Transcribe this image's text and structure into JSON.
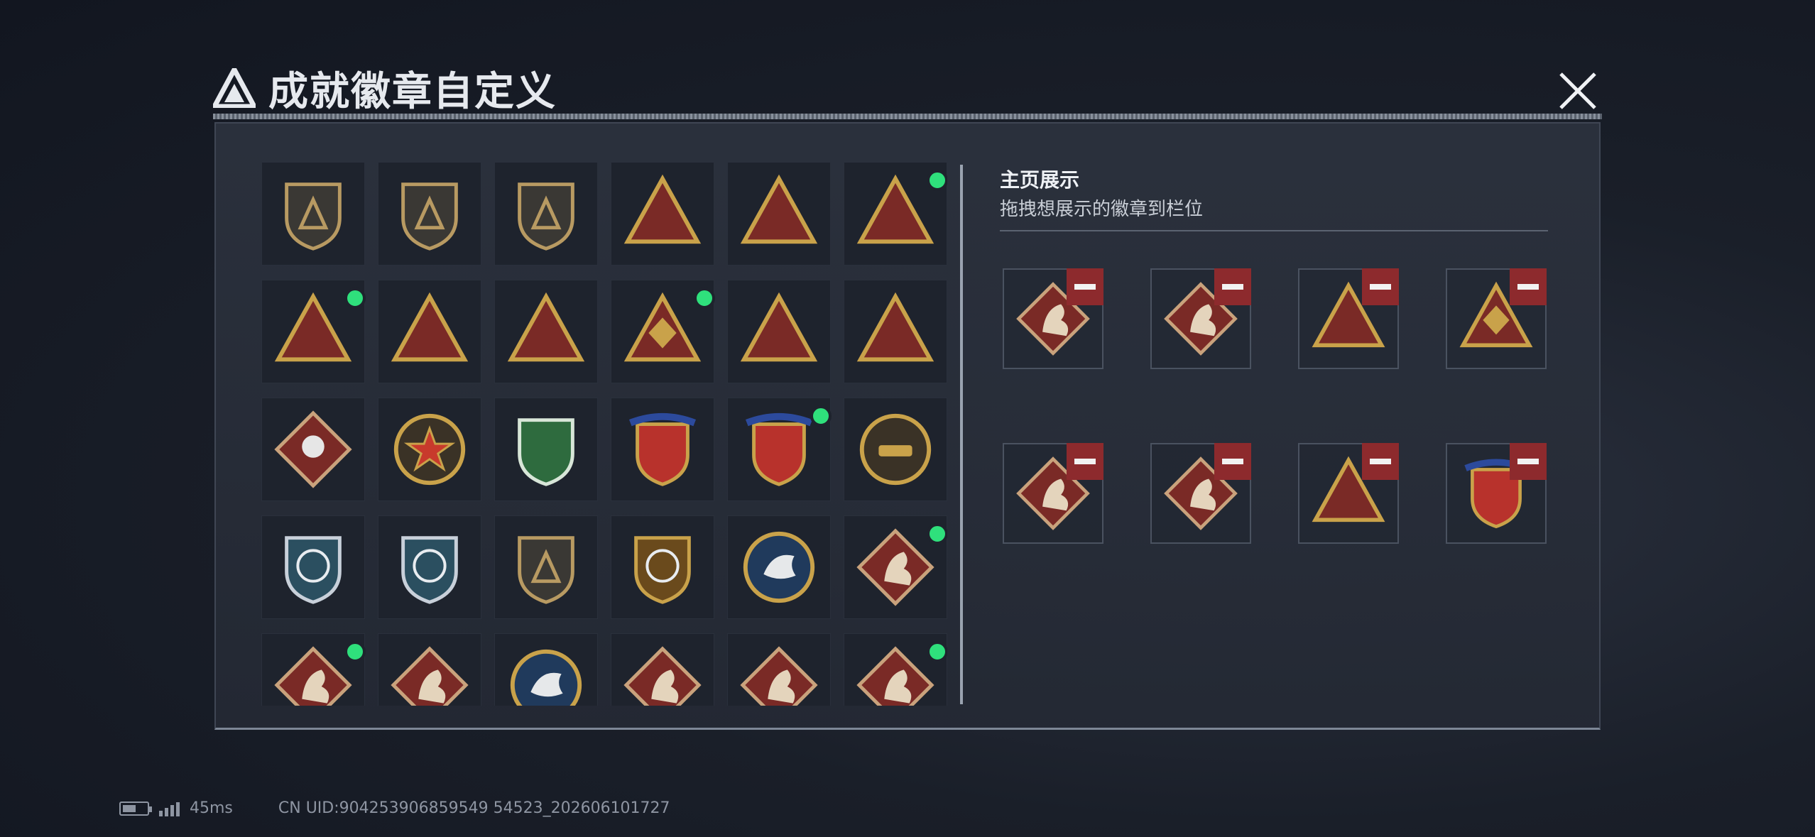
{
  "window": {
    "title": "成就徽章自定义",
    "logo_icon": "triangle-logo-icon",
    "close_icon": "close-icon"
  },
  "colors": {
    "accent_green": "#2fe07c",
    "remove_red": "#8d2a2d",
    "gold": "#c9a24a",
    "maroon": "#7a2a26"
  },
  "badge_grid": {
    "badges": [
      {
        "id": "b1",
        "icon": "triangle-shield-badge-icon",
        "equipped": false
      },
      {
        "id": "b2",
        "icon": "helicopter-shield-badge-icon",
        "equipped": false
      },
      {
        "id": "b3",
        "icon": "dagger-shield-badge-icon",
        "equipped": false
      },
      {
        "id": "b4",
        "icon": "sack-triangle-badge-icon",
        "equipped": false
      },
      {
        "id": "b5",
        "icon": "winged-triangle-badge-icon",
        "equipped": false
      },
      {
        "id": "b6",
        "icon": "medal-triangle-badge-icon",
        "equipped": true
      },
      {
        "id": "b7",
        "icon": "trophy-triangle-badge-icon",
        "equipped": true
      },
      {
        "id": "b8",
        "icon": "ship-triangle-badge-icon",
        "equipped": false
      },
      {
        "id": "b9",
        "icon": "number-one-triangle-badge-icon",
        "equipped": false
      },
      {
        "id": "b10",
        "icon": "hands-diamond-triangle-badge-icon",
        "equipped": true
      },
      {
        "id": "b11",
        "icon": "squad-triangle-badge-icon",
        "equipped": false
      },
      {
        "id": "b12",
        "icon": "rocket-triangle-badge-icon",
        "equipped": false
      },
      {
        "id": "b13",
        "icon": "rose-diamond-badge-icon",
        "equipped": false
      },
      {
        "id": "b14",
        "icon": "star-round-badge-icon",
        "equipped": false
      },
      {
        "id": "b15",
        "icon": "green-shield-badge-icon",
        "equipped": false
      },
      {
        "id": "b16",
        "icon": "banner-shield-badge-icon",
        "equipped": false
      },
      {
        "id": "b17",
        "icon": "banner-gem-shield-badge-icon",
        "equipped": true
      },
      {
        "id": "b18",
        "icon": "tank-round-badge-icon",
        "equipped": false
      },
      {
        "id": "b19",
        "icon": "rifle-crosshair-badge-icon",
        "equipped": false
      },
      {
        "id": "b20",
        "icon": "rifle-crosshair-badge-icon",
        "equipped": false
      },
      {
        "id": "b21",
        "icon": "rifle-shield-badge-icon",
        "equipped": false
      },
      {
        "id": "b22",
        "icon": "gold-crosshair-shield-badge-icon",
        "equipped": false
      },
      {
        "id": "b23",
        "icon": "eagle-round-badge-icon",
        "equipped": false
      },
      {
        "id": "b24",
        "icon": "dragon-diamond-badge-icon",
        "equipped": true
      },
      {
        "id": "b25",
        "icon": "dragon-diamond-badge-icon",
        "equipped": true
      },
      {
        "id": "b26",
        "icon": "runner-diamond-badge-icon",
        "equipped": false
      },
      {
        "id": "b27",
        "icon": "wolf-round-badge-icon",
        "equipped": false
      },
      {
        "id": "b28",
        "icon": "snake-diamond-badge-icon",
        "equipped": false
      },
      {
        "id": "b29",
        "icon": "wheel-diamond-badge-icon",
        "equipped": false
      },
      {
        "id": "b30",
        "icon": "horse-diamond-badge-icon",
        "equipped": true
      }
    ]
  },
  "showcase": {
    "title": "主页展示",
    "subtitle": "拖拽想展示的徽章到栏位",
    "remove_icon": "minus-icon",
    "slots": [
      {
        "id": "s1",
        "icon": "dragon-diamond-badge-icon"
      },
      {
        "id": "s2",
        "icon": "horse-diamond-badge-icon"
      },
      {
        "id": "s3",
        "icon": "medal-triangle-badge-icon"
      },
      {
        "id": "s4",
        "icon": "hands-diamond-triangle-badge-icon"
      },
      {
        "id": "s5",
        "icon": "dragon-diamond-badge-icon"
      },
      {
        "id": "s6",
        "icon": "horse-diamond-badge-icon"
      },
      {
        "id": "s7",
        "icon": "trophy-triangle-badge-icon"
      },
      {
        "id": "s8",
        "icon": "banner-gem-shield-badge-icon"
      }
    ]
  },
  "status_bar": {
    "battery_icon": "battery-icon",
    "battery_level": 0.55,
    "signal_icon": "signal-bars-icon",
    "latency": "45ms",
    "uid_text": "CN UID:904253906859549 54523_202606101727"
  }
}
